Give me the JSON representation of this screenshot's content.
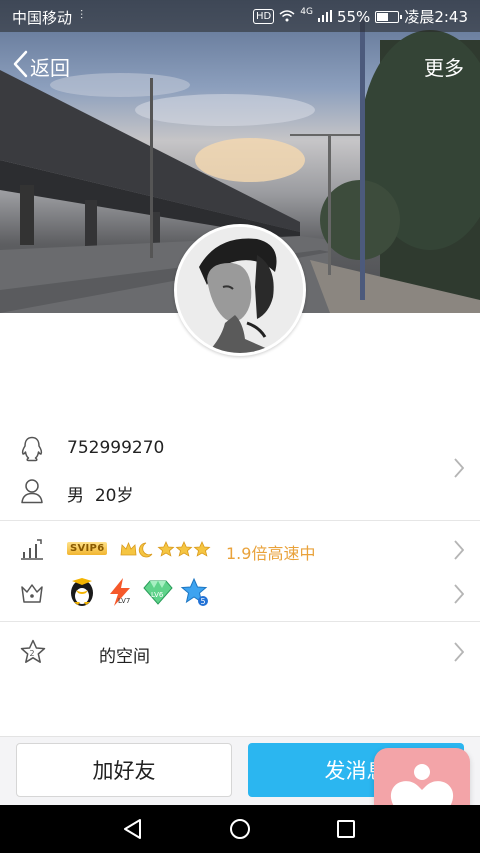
{
  "status_bar": {
    "carrier": "中国移动",
    "hd": "HD",
    "network": "4G",
    "battery_percent": "55%",
    "battery_level": 0.55,
    "time": "凌晨2:43"
  },
  "nav": {
    "back_label": "返回",
    "more_label": "更多"
  },
  "profile": {
    "qq_number": "752999270",
    "gender": "男",
    "age": "20岁"
  },
  "vip": {
    "badge": "SVIP6",
    "speed_text": "1.9倍高速中"
  },
  "space": {
    "label": "的空间"
  },
  "actions": {
    "add_friend": "加好友",
    "send_message": "发消息"
  },
  "colors": {
    "accent": "#2bb6f0",
    "speed": "#e9a23b",
    "floating": "#f3a4a8"
  }
}
